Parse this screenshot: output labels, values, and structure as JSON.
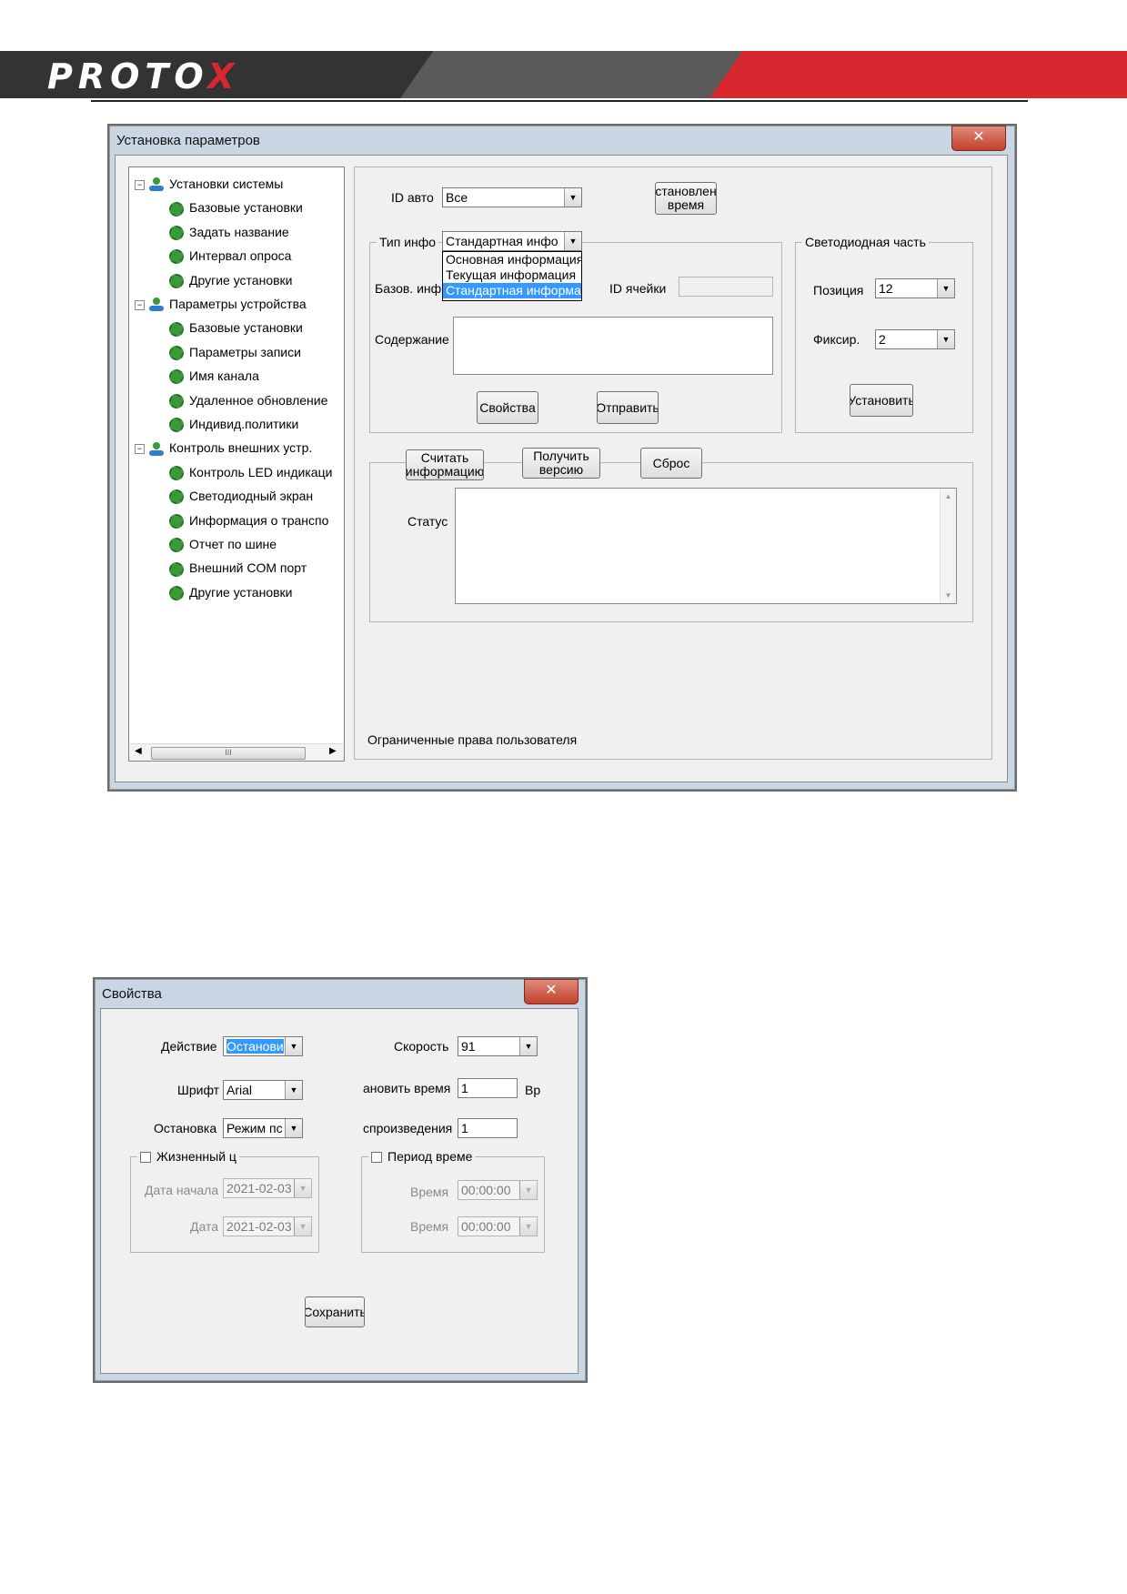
{
  "header": {
    "logo_main": "PROTO",
    "logo_accent": "X"
  },
  "settings_window": {
    "title": "Установка параметров",
    "close": "✕",
    "tree": [
      {
        "label": "Установки системы",
        "level": 0
      },
      {
        "label": "Базовые установки",
        "level": 1
      },
      {
        "label": "Задать название",
        "level": 1
      },
      {
        "label": "Интервал опроса",
        "level": 1
      },
      {
        "label": "Другие установки",
        "level": 1
      },
      {
        "label": "Параметры устройства",
        "level": 0
      },
      {
        "label": "Базовые установки",
        "level": 1
      },
      {
        "label": "Параметры записи",
        "level": 1
      },
      {
        "label": "Имя канала",
        "level": 1
      },
      {
        "label": "Удаленное обновление",
        "level": 1
      },
      {
        "label": "Индивид.политики",
        "level": 1
      },
      {
        "label": "Контроль внешних устр.",
        "level": 0
      },
      {
        "label": "Контроль LED индикаци",
        "level": 1
      },
      {
        "label": "Светодиодный экран",
        "level": 1
      },
      {
        "label": "Информация о транспо",
        "level": 1
      },
      {
        "label": "Отчет по шине",
        "level": 1
      },
      {
        "label": "Внешний COM порт",
        "level": 1
      },
      {
        "label": "Другие установки",
        "level": 1
      }
    ],
    "scroll_thumb": "III",
    "id_auto_label": "ID авто",
    "id_auto_value": "Все",
    "set_time_button": "становлен\nвремя",
    "info_type_label": "Тип инфо",
    "info_type_value": "Стандартная инфо",
    "info_type_options": [
      "Основная информация",
      "Текущая информация",
      "Стандартная информа"
    ],
    "base_info_label": "Базов. инф",
    "cell_id_label": "ID ячейки",
    "content_label": "Содержание",
    "properties_button": "Свойства",
    "send_button": "Отправить",
    "led_group_title": "Светодиодная часть",
    "position_label": "Позиция",
    "position_value": "12",
    "fix_label": "Фиксир.",
    "fix_value": "2",
    "install_button": "Установить",
    "read_info_button": "Считать\nинформацию",
    "get_version_button": "Получить\nверсию",
    "reset_button": "Сброс",
    "status_label": "Статус",
    "footer_status": "Ограниченные права пользователя"
  },
  "properties_window": {
    "title": "Свойства",
    "close": "✕",
    "action_label": "Действие",
    "action_value": "Останови",
    "speed_label": "Скорость",
    "speed_value": "91",
    "font_label": "Шрифт",
    "font_value": "Arial",
    "settime_label": "ановить время",
    "settime_value": "1",
    "settime_unit": "Вр",
    "stop_label": "Остановка",
    "stop_value": "Режим пс",
    "playback_label": "спроизведения",
    "playback_value": "1",
    "lifecycle_title": "Жизненный ц",
    "start_date_label": "Дата начала",
    "start_date_value": "2021-02-03",
    "date_label": "Дата",
    "date_value": "2021-02-03",
    "period_title": "Период време",
    "time1_label": "Время",
    "time1_value": "00:00:00",
    "time2_label": "Время",
    "time2_value": "00:00:00",
    "save_button": "Сохранить"
  }
}
